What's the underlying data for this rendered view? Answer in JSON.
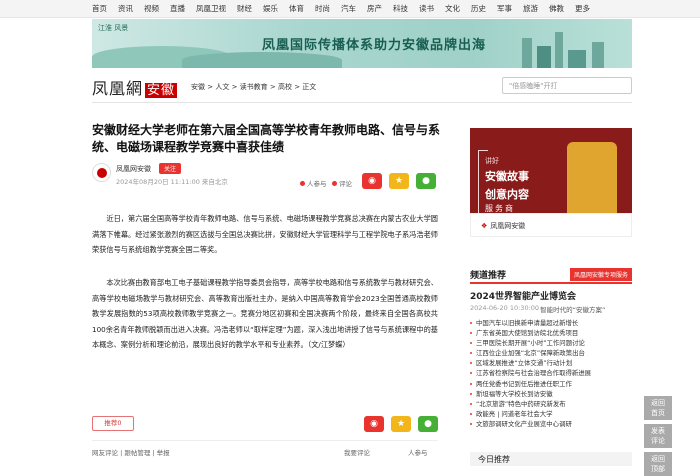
{
  "topnav": {
    "items": [
      "首页",
      "资讯",
      "视频",
      "直播",
      "凤凰卫视",
      "财经",
      "娱乐",
      "体育",
      "时尚",
      "汽车",
      "房产",
      "科技",
      "读书",
      "文化",
      "历史",
      "军事",
      "旅游",
      "佛教",
      "更多"
    ]
  },
  "banner": {
    "logo_text": "江淮 风景",
    "title": "凤凰国际传播体系助力安徽品牌出海"
  },
  "header": {
    "brand": "凤凰網",
    "brand_red": "安徽",
    "breadcrumb": "安徽 > 人文 > 读书教育 > 高校 > 正文",
    "search_placeholder": "\"倍感瞌睡\"开打"
  },
  "article": {
    "title": "安徽财经大学老师在第六届全国高等学校青年教师电路、信号与系统、电磁场课程教学竞赛中喜获佳绩",
    "author": "凤凰网安徽",
    "follow": "关注",
    "date": "2024年08月20日 11:11:00 来自北京",
    "stats": {
      "participants": "人参与",
      "comments": "评论"
    },
    "paragraphs": [
      "近日，第六届全国高等学校青年教师电路、信号与系统、电磁场课程教学竞赛总决赛在内蒙古农业大学圆满落下帷幕。经过紧张激烈的赛区选拔与全国总决赛比拼，安徽财经大学管理科学与工程学院电子系冯浩老师荣获信号与系统组教学竞赛全国二等奖。",
      "本次比赛由教育部电工电子基础课程教学指导委员会指导，高等学校电路和信号系统教学与教材研究会、高等学校电磁场教学与教材研究会、高等教育出版社主办，是纳入中国高等教育学会2023全国普通高校教师教学发展指数的53项高校教师教学竞赛之一。竞赛分地区初赛和全国决赛两个阶段，最终来自全国各高校共100余名青年教师脱颖而出进入决赛。冯浩老师以“取样定理”为题，深入浅出地讲授了信号与系统课程中的基本概念、案例分析和理论前沿，展现出良好的教学水平和专业素养。（文/江梦蝶）"
    ],
    "recommend": "推荐0"
  },
  "footer": {
    "left": "网友评论 | 跟帖管理 | 举报",
    "comments": "我要评论",
    "participants": "人参与"
  },
  "ad": {
    "line1": "讲好",
    "line2": "安徽故事",
    "line3": "创意内容",
    "line4": "服务商",
    "brand": "凤凰网安徽",
    "brand_tag": "凤凰网安徽"
  },
  "sidebar": {
    "channel_title": "频道推荐",
    "channel_tag": "凤凰网安徽专项服务",
    "feature_title": "2024世界智能产业博览会",
    "feature_date": "2024-06-20 10:30:00",
    "feature_meta": "· 智能时代的“安徽方案”",
    "news": [
      "中国汽车以旧换新申请量超过新增长",
      "广东省英国大使馆到访皖北优秀项目",
      "三甲医院长期开展“小时”工作问题讨论",
      "江西位企业加强“北京”保障新政策出台",
      "区域发展推进“立体交通”行动计划",
      "江苏省检察院与社会治理合作取得新进展",
      "两任党委书记到任后推进任职工作",
      "斯坦福等大学校长到访安徽",
      "“北京旅游”特色中药研究新发布",
      "政能亮 | 问道老年社会大学",
      "文旅部调研文化产业展览中心调研"
    ],
    "today": "今日推荐"
  },
  "side_tools": [
    "返回\n首页",
    "发表\n评论",
    "返回\n顶部"
  ]
}
